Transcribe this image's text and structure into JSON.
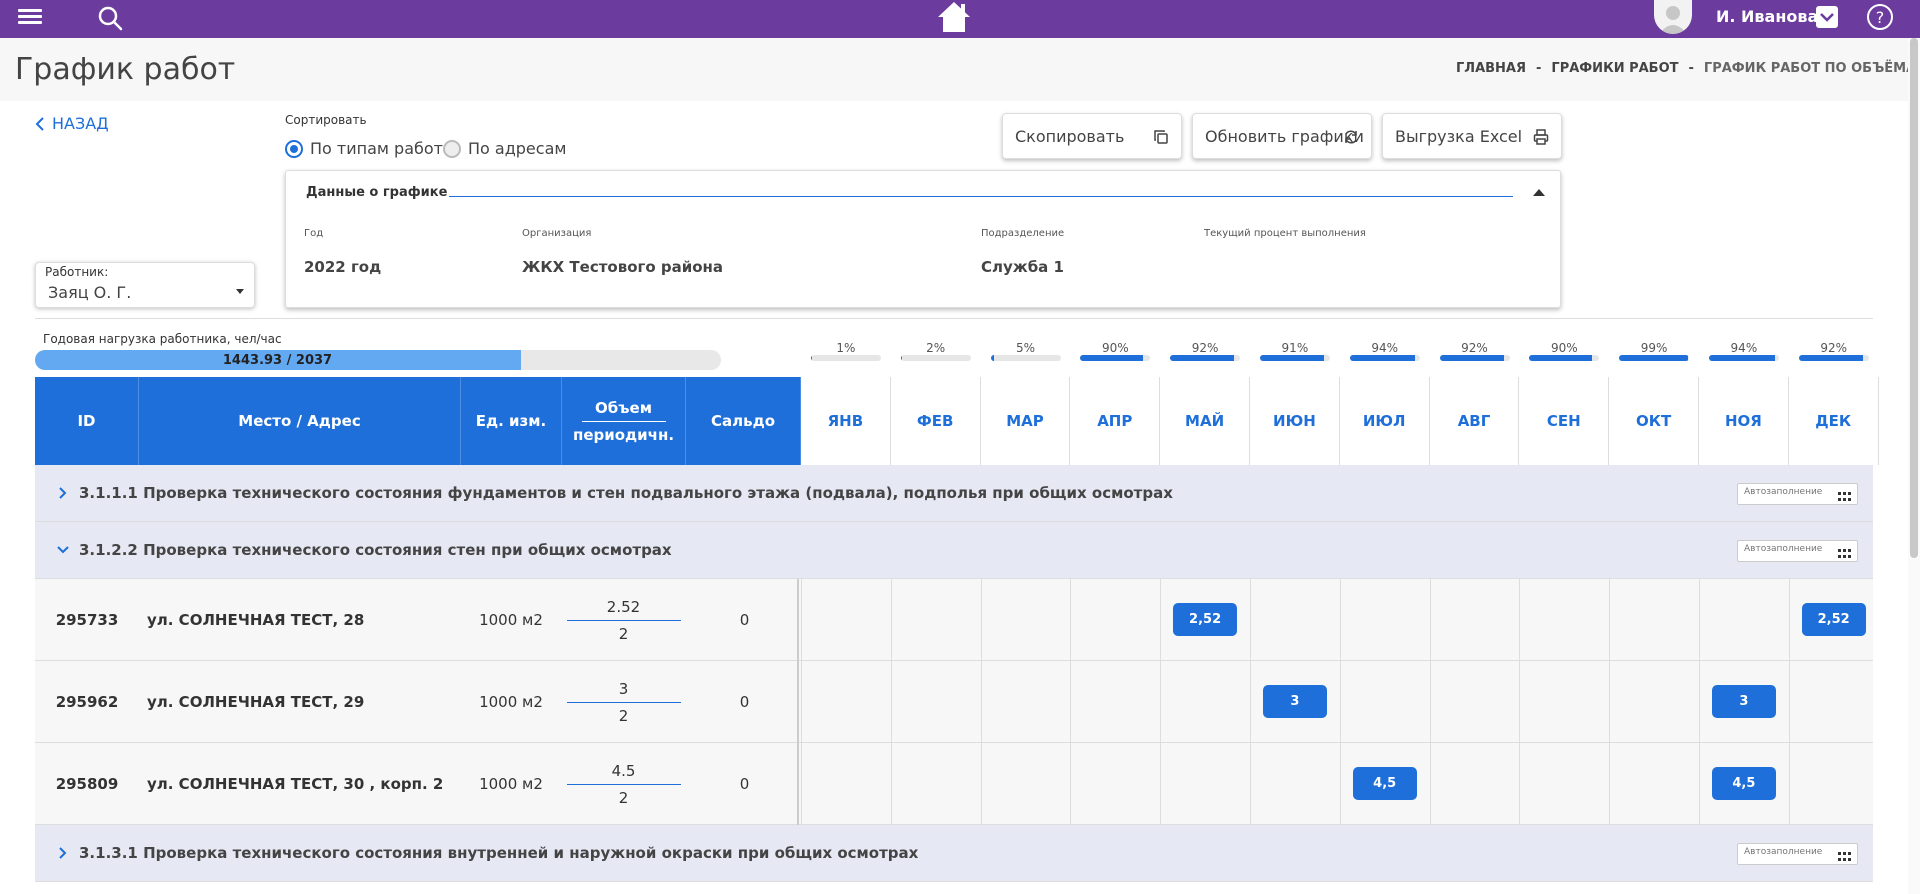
{
  "user": {
    "name": "И. Иванова"
  },
  "page": {
    "title": "График работ"
  },
  "breadcrumbs": [
    "ГЛАВНАЯ",
    "ГРАФИКИ РАБОТ",
    "ГРАФИК РАБОТ ПО ОБЪЁМАМ"
  ],
  "back_label": "НАЗАД",
  "sort": {
    "label": "Сортировать",
    "options": [
      "По типам работ",
      "По адресам"
    ],
    "selected": "По типам работ"
  },
  "toolbar": {
    "copy": "Скопировать",
    "refresh": "Обновить графики",
    "export": "Выгрузка Excel"
  },
  "info": {
    "title": "Данные о графике",
    "fields": [
      {
        "label": "Год",
        "value": "2022 год"
      },
      {
        "label": "Организация",
        "value": "ЖКХ Тестового района"
      },
      {
        "label": "Подразделение",
        "value": "Служба 1"
      },
      {
        "label": "Текущий процент выполнения",
        "value": ""
      }
    ]
  },
  "worker": {
    "label": "Работник:",
    "value": "Заяц О. Г."
  },
  "load": {
    "label": "Годовая нагрузка работника, чел/час",
    "text": "1443.93 / 2037",
    "fraction": 0.7089
  },
  "months": [
    {
      "name": "ЯНВ",
      "pct": "1%"
    },
    {
      "name": "ФЕВ",
      "pct": "2%"
    },
    {
      "name": "МАР",
      "pct": "5%"
    },
    {
      "name": "АПР",
      "pct": "90%"
    },
    {
      "name": "МАЙ",
      "pct": "92%"
    },
    {
      "name": "ИЮН",
      "pct": "91%"
    },
    {
      "name": "ИЮЛ",
      "pct": "94%"
    },
    {
      "name": "АВГ",
      "pct": "92%"
    },
    {
      "name": "СЕН",
      "pct": "90%"
    },
    {
      "name": "ОКТ",
      "pct": "99%"
    },
    {
      "name": "НОЯ",
      "pct": "94%"
    },
    {
      "name": "ДЕК",
      "pct": "92%"
    }
  ],
  "columns": {
    "id": "ID",
    "address": "Место / Адрес",
    "unit": "Ед. изм.",
    "volume": "Объем",
    "period": "периодичн.",
    "saldo": "Сальдо"
  },
  "autofill_placeholder": "Автозаполнение",
  "groups": [
    {
      "title": "3.1.1.1 Проверка технического состояния фундаментов и стен подвального этажа (подвала), подполья при общих осмотрах",
      "expanded": false
    },
    {
      "title": "3.1.2.2 Проверка технического состояния стен при общих осмотрах",
      "expanded": true
    },
    {
      "title": "3.1.3.1 Проверка технического состояния внутренней и наружной окраски при общих осмотрах",
      "expanded": false
    }
  ],
  "rows": [
    {
      "id": "295733",
      "address": "ул. СОЛНЕЧНАЯ ТЕСТ, 28",
      "unit": "1000 м2",
      "volume": "2.52",
      "period": "2",
      "saldo": "0",
      "marks": [
        {
          "month": 4,
          "value": "2,52"
        },
        {
          "month": 11,
          "value": "2,52"
        }
      ]
    },
    {
      "id": "295962",
      "address": "ул. СОЛНЕЧНАЯ ТЕСТ, 29",
      "unit": "1000 м2",
      "volume": "3",
      "period": "2",
      "saldo": "0",
      "marks": [
        {
          "month": 5,
          "value": "3"
        },
        {
          "month": 10,
          "value": "3"
        }
      ]
    },
    {
      "id": "295809",
      "address": "ул. СОЛНЕЧНАЯ ТЕСТ, 30 , корп. 2",
      "unit": "1000 м2",
      "volume": "4.5",
      "period": "2",
      "saldo": "0",
      "marks": [
        {
          "month": 6,
          "value": "4,5"
        },
        {
          "month": 10,
          "value": "4,5"
        }
      ]
    }
  ],
  "colors": {
    "topbar": "#6c3b9e",
    "accent": "#1e6fd9",
    "group_bg": "#e6e8f3",
    "load_fill": "#63a9f2"
  }
}
